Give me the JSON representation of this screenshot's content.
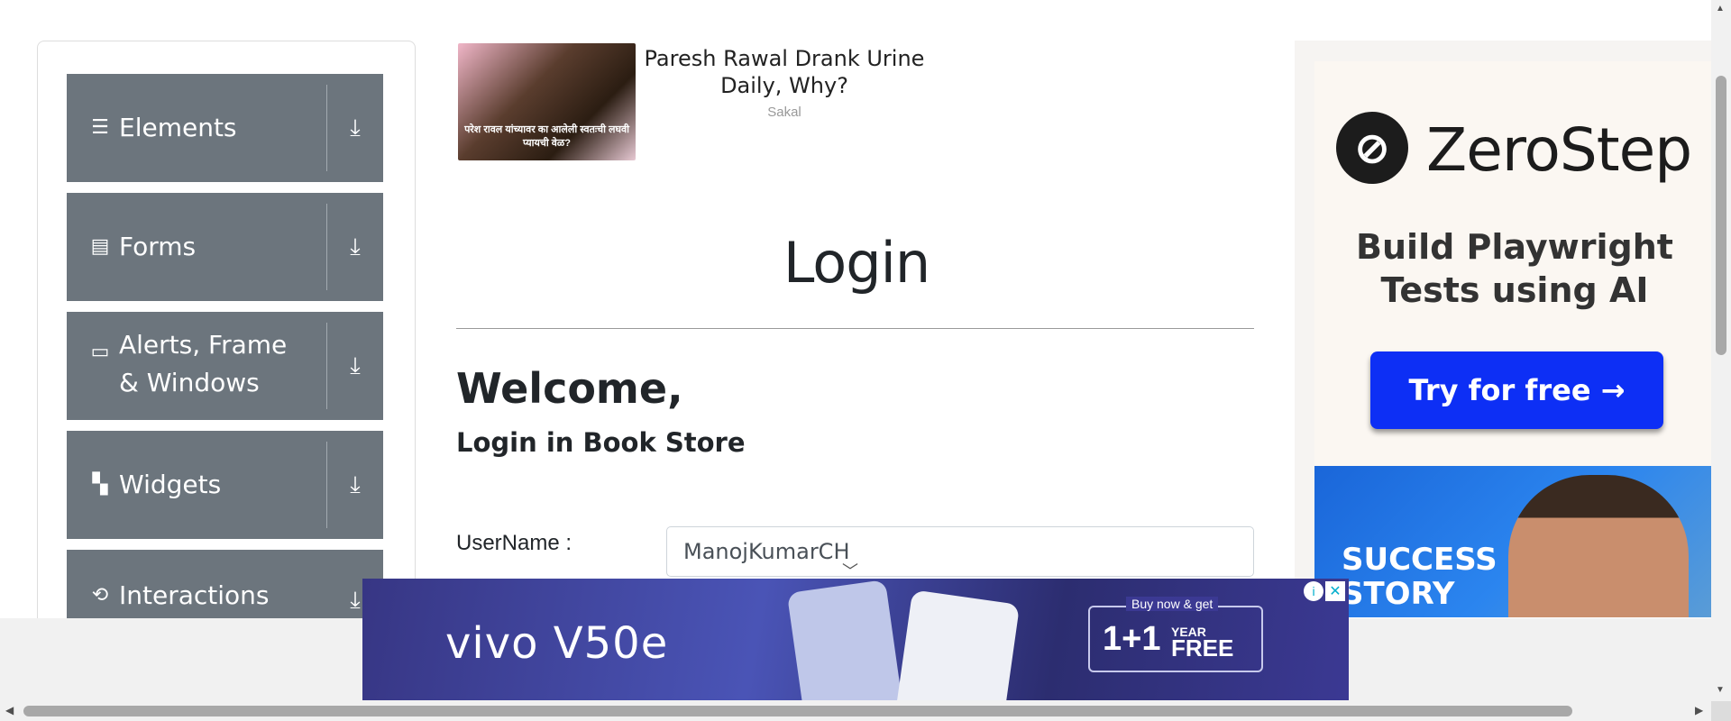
{
  "nav": {
    "groups": [
      {
        "label": "Elements",
        "icon": "hamburger-icon"
      },
      {
        "label": "Forms",
        "icon": "document-icon"
      },
      {
        "label": "Alerts, Frame & Windows",
        "icon": "window-icon"
      },
      {
        "label": "Widgets",
        "icon": "widgets-icon"
      },
      {
        "label": "Interactions",
        "icon": "interactions-icon"
      }
    ],
    "download_icon": "download-icon"
  },
  "news_ad": {
    "title": "Paresh Rawal Drank Urine Daily, Why?",
    "source": "Sakal",
    "thumb_caption": "परेश रावल यांच्यावर का आलेली स्वतःची लघवी प्यायची वेळ?"
  },
  "page": {
    "title": "Login",
    "welcome": "Welcome,",
    "subtitle": "Login in Book Store"
  },
  "form": {
    "username_label": "UserName :",
    "username_value": "ManojKumarCH"
  },
  "right_ad": {
    "brand": "ZeroStep",
    "tagline": "Build Playwright Tests using AI",
    "cta": "Try for free →",
    "story": "SUCCESS STORY",
    "accent": "#0d2ff5"
  },
  "bottom_ad": {
    "brand": "vivo V50e",
    "offer_top": "Buy now & get",
    "offer_big": "1+1",
    "offer_year": "YEAR",
    "offer_free": "FREE",
    "info": "i",
    "close": "✕"
  }
}
